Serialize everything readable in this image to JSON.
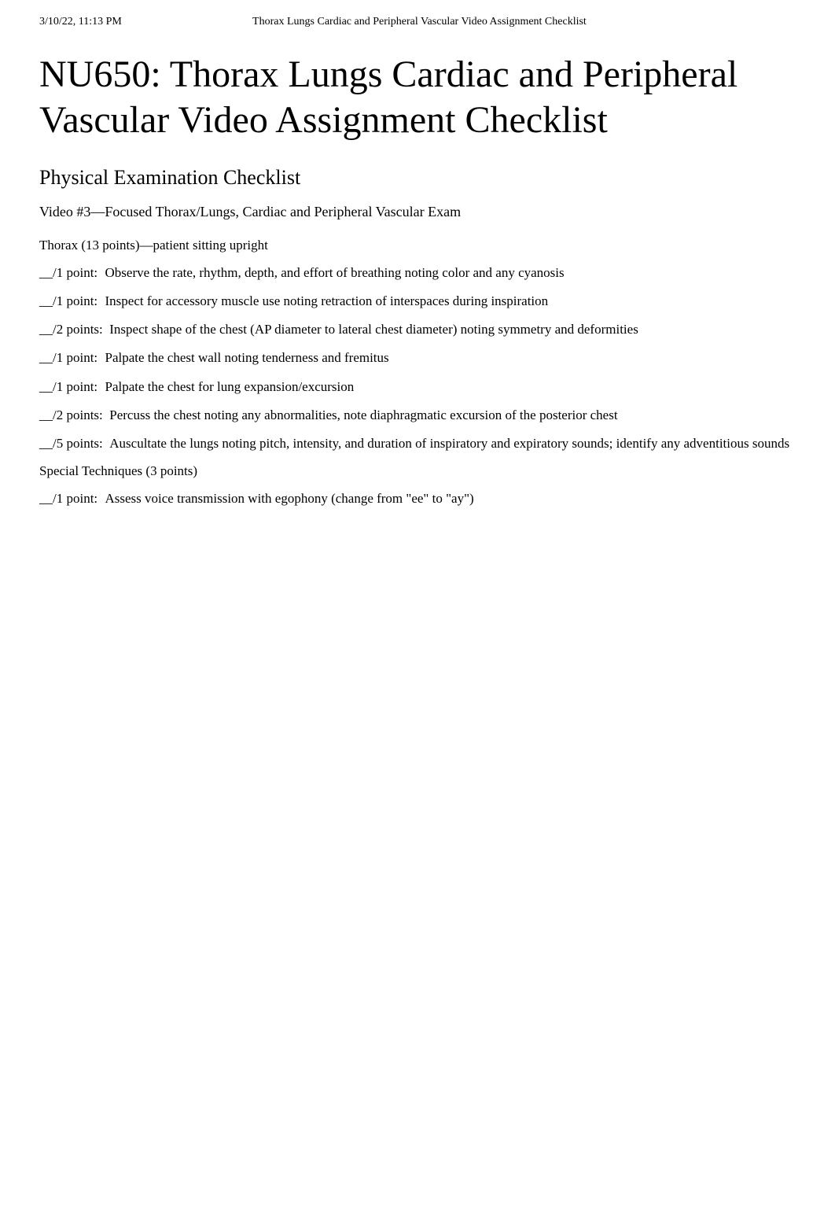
{
  "header": {
    "timestamp": "3/10/22, 11:13 PM",
    "doc_title": "Thorax Lungs Cardiac and Peripheral Vascular Video Assignment Checklist"
  },
  "title": "NU650: Thorax Lungs Cardiac and Peripheral Vascular Video Assignment Checklist",
  "subtitle": "Physical Examination Checklist",
  "video_title": "Video #3—Focused Thorax/Lungs, Cardiac and Peripheral Vascular Exam",
  "sections": [
    {
      "header": "Thorax (13 points)—patient sitting upright",
      "items": [
        {
          "points": "__/1 point:",
          "text": "Observe the rate, rhythm, depth, and effort of breathing noting color and any cyanosis"
        },
        {
          "points": "__/1 point:",
          "text": "Inspect for accessory muscle use noting retraction of interspaces during inspiration"
        },
        {
          "points": "__/2 points:",
          "text": "Inspect shape of the chest (AP diameter to lateral chest diameter) noting symmetry and deformities"
        },
        {
          "points": "__/1 point:",
          "text": "Palpate the chest wall noting tenderness and fremitus"
        },
        {
          "points": "__/1 point:",
          "text": "Palpate the chest for lung expansion/excursion"
        },
        {
          "points": "__/2 points:",
          "text": "Percuss the chest noting any abnormalities, note diaphragmatic excursion of the posterior chest"
        },
        {
          "points": "__/5 points:",
          "text": "Auscultate the lungs noting pitch, intensity, and duration of inspiratory and expiratory sounds; identify any adventitious sounds"
        }
      ]
    },
    {
      "header": "Special Techniques (3 points)",
      "items": [
        {
          "points": "__/1 point:",
          "text": "Assess voice transmission with egophony (change from \"ee\" to \"ay\")"
        }
      ]
    }
  ]
}
